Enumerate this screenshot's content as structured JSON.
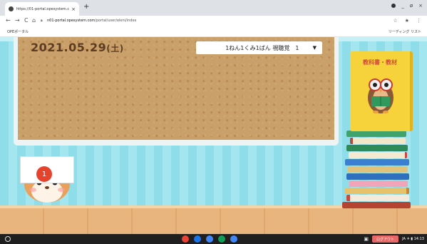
{
  "browser": {
    "tab_title": "https://01-portal.opesystem.c",
    "tab_close": "×",
    "new_tab": "+",
    "url_host": "n01-portal.opesystem.com",
    "url_path": "/portal/user/eleni/index",
    "bookmark": "OPEポータル",
    "reading_list": "リーディング リスト",
    "back": "←",
    "forward": "→",
    "reload": "C",
    "home": "⌂",
    "win_minimize": "_",
    "win_restore": "ø",
    "win_close": "×"
  },
  "board": {
    "date": "2021.05.29",
    "day_of_week": "(土)",
    "class_select": "1ねん1くみ1ばん 視聴覚　1",
    "class_select_arrow": "▼"
  },
  "textbook": {
    "title": "教科書・教材"
  },
  "hamster": {
    "seal_number": "1"
  },
  "taskbar": {
    "logout": "ログアウト",
    "status": "JA ✈ ▮ 14:13",
    "app_colors": [
      "#ea4335",
      "#1a73e8",
      "#4285f4",
      "#0f9d58",
      "#4285f4"
    ]
  }
}
